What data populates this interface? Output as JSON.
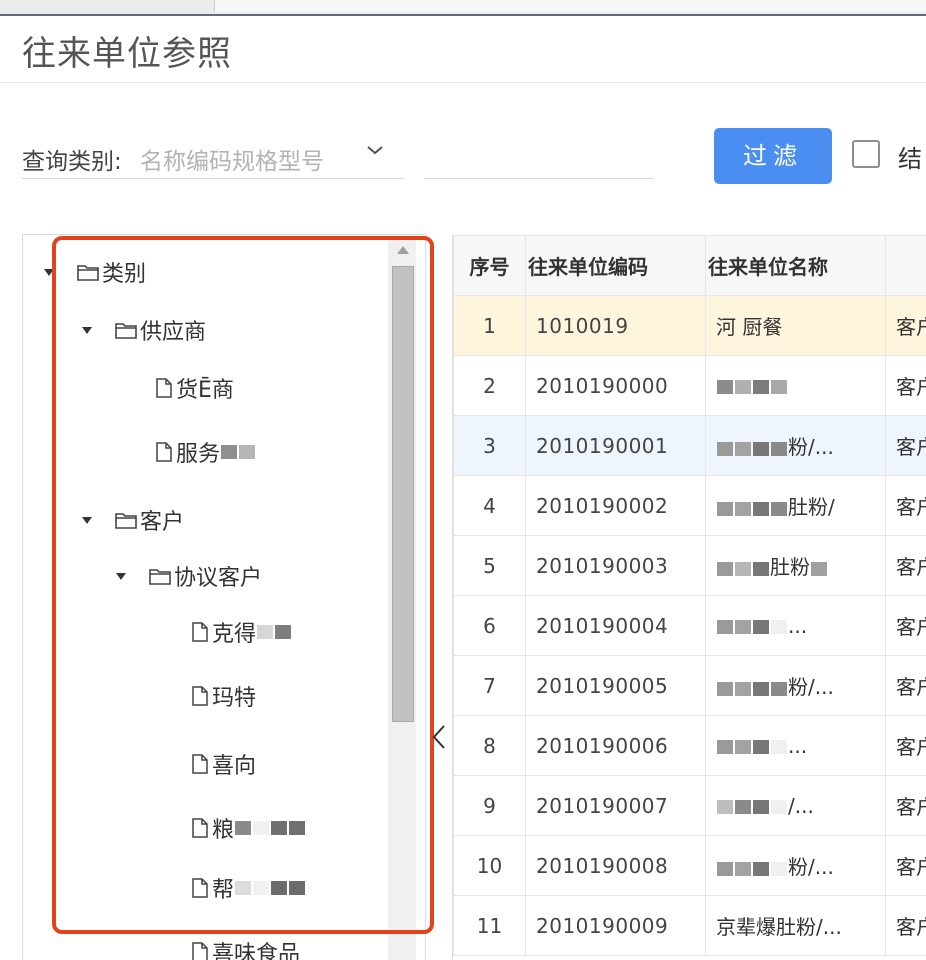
{
  "page": {
    "title": "往来单位参照"
  },
  "filter": {
    "label": "查询类别:",
    "value": "名称编码规格型号",
    "filter_button": "过滤",
    "checkbox_label": "结"
  },
  "tree": {
    "nodes": [
      {
        "label": "类别",
        "type": "folder",
        "expanded": true
      },
      {
        "label": "供应商",
        "type": "folder",
        "expanded": true
      },
      {
        "label": "货Ē商",
        "type": "file"
      },
      {
        "label": "服务",
        "type": "file"
      },
      {
        "label": "客户",
        "type": "folder",
        "expanded": true
      },
      {
        "label": "协议客户",
        "type": "folder",
        "expanded": true
      },
      {
        "label": "克得",
        "type": "file"
      },
      {
        "label": "玛特",
        "type": "file"
      },
      {
        "label": "喜向",
        "type": "file"
      },
      {
        "label": "粮",
        "type": "file"
      },
      {
        "label": "帮",
        "type": "file"
      },
      {
        "label": "喜味食品",
        "type": "file"
      }
    ]
  },
  "table": {
    "columns": [
      "序号",
      "往来单位编码",
      "往来单位名称",
      ""
    ],
    "rows": [
      {
        "no": "1",
        "code": "1010019",
        "name": "河 厨餐",
        "type": "客户"
      },
      {
        "no": "2",
        "code": "2010190000",
        "name": "",
        "type": "客户"
      },
      {
        "no": "3",
        "code": "2010190001",
        "name": "粉/...",
        "type": "客户"
      },
      {
        "no": "4",
        "code": "2010190002",
        "name": "肚粉/",
        "type": "客户"
      },
      {
        "no": "5",
        "code": "2010190003",
        "name": "肚粉",
        "type": "客户"
      },
      {
        "no": "6",
        "code": "2010190004",
        "name": "...",
        "type": "客户"
      },
      {
        "no": "7",
        "code": "2010190005",
        "name": "粉/...",
        "type": "客户"
      },
      {
        "no": "8",
        "code": "2010190006",
        "name": "...",
        "type": "客户"
      },
      {
        "no": "9",
        "code": "2010190007",
        "name": "/...",
        "type": "客户"
      },
      {
        "no": "10",
        "code": "2010190008",
        "name": "粉/...",
        "type": "客户"
      },
      {
        "no": "11",
        "code": "2010190009",
        "name": "京辈爆肚粉/...",
        "type": "客户"
      }
    ]
  },
  "colors": {
    "primary": "#4b8ef2",
    "highlight_border": "#e4421c",
    "selected_row": "#fdf5dc"
  }
}
